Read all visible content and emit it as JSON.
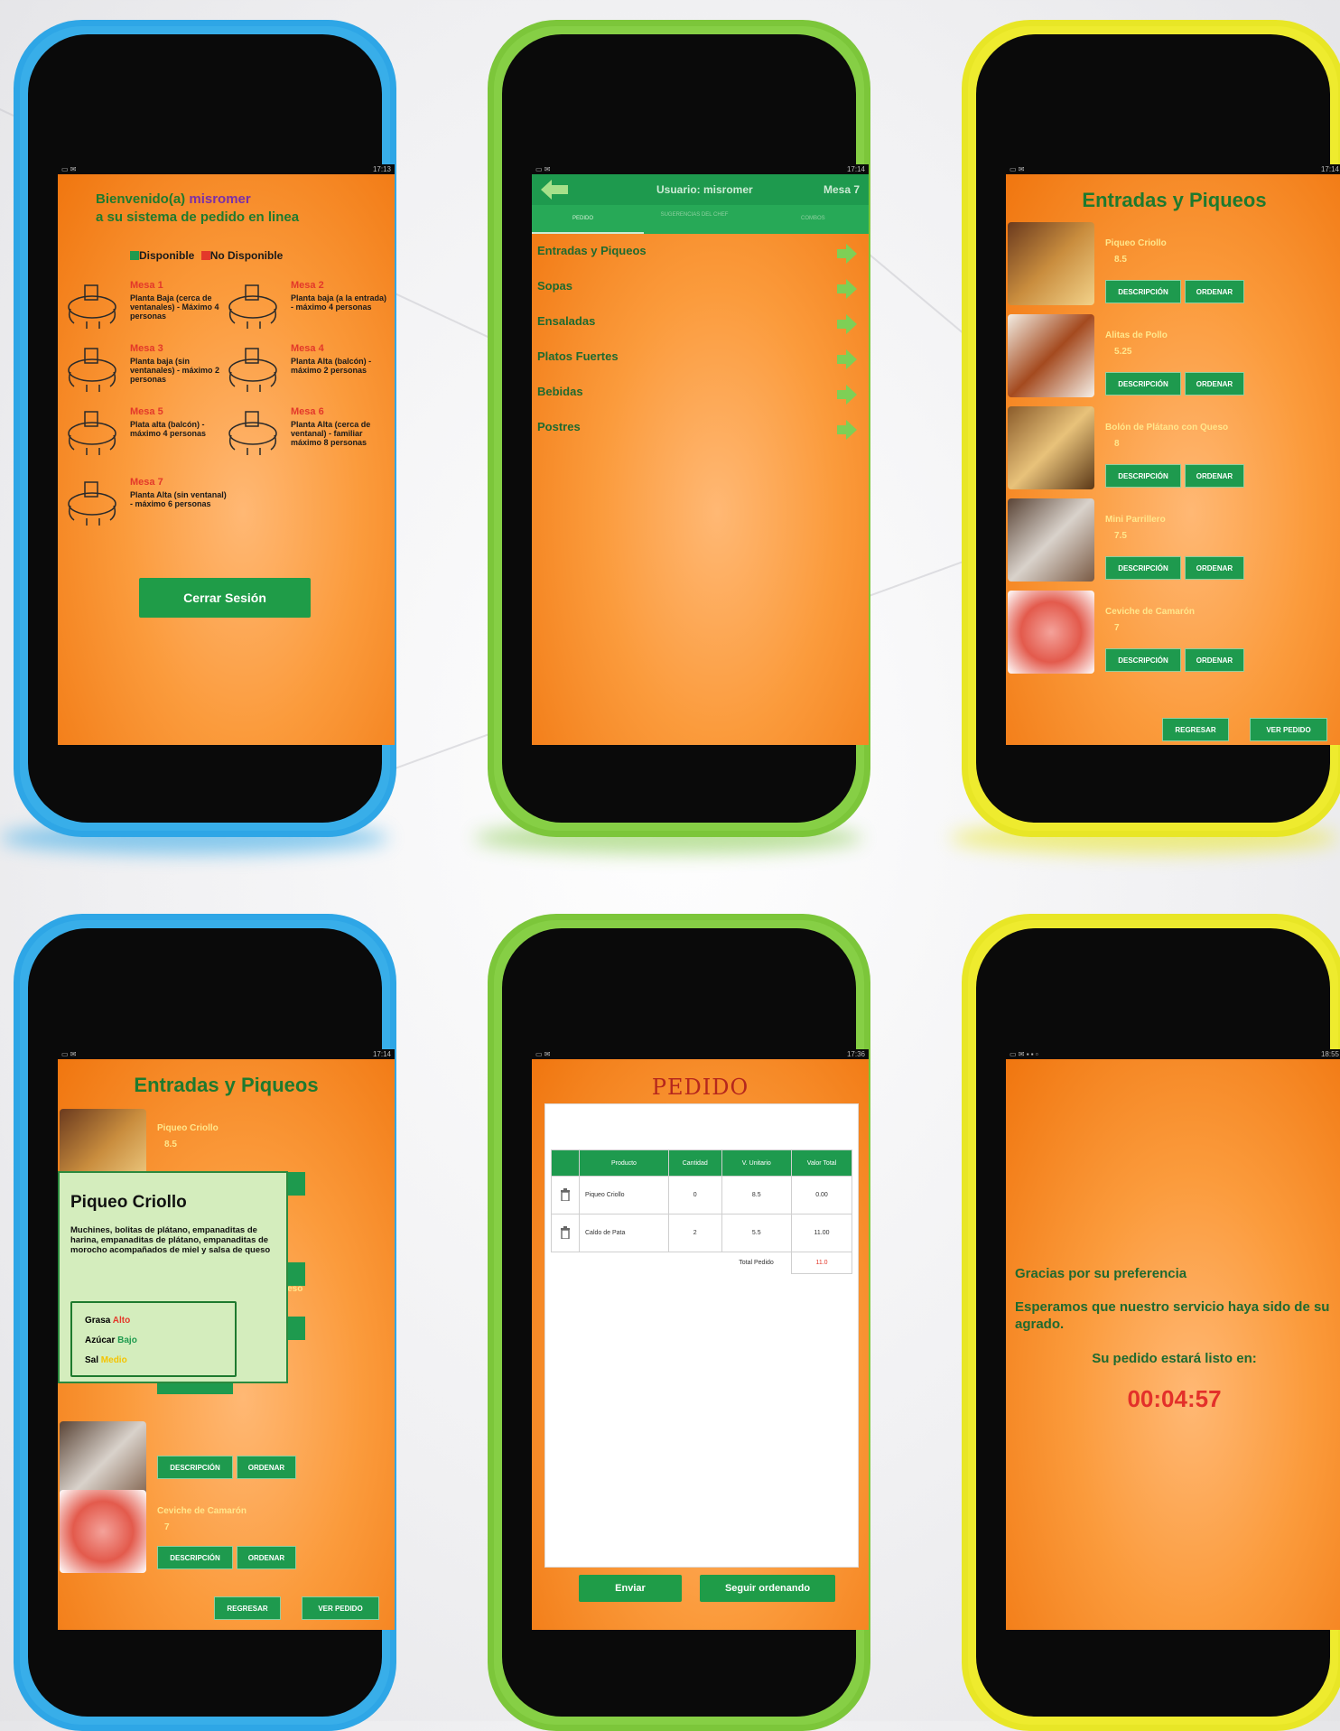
{
  "status_bar": {
    "time_1": "17:13",
    "time_2": "17:14",
    "time_3": "17:14",
    "time_4": "17:14",
    "time_5": "17:36",
    "time_6": "18:55"
  },
  "screen1": {
    "welcome_prefix": "Bienvenido(a) ",
    "username": "misromer",
    "subtitle": "a su sistema de pedido en linea",
    "legend_available": "Disponible",
    "legend_unavailable": "No Disponible",
    "available_color": "#1e9a4e",
    "unavailable_color": "#e3382a",
    "tables": [
      {
        "name": "Mesa 1",
        "desc": "Planta Baja (cerca de ventanales) - Máximo 4 personas"
      },
      {
        "name": "Mesa 2",
        "desc": "Planta baja (a la entrada) - máximo 4 personas"
      },
      {
        "name": "Mesa 3",
        "desc": "Planta baja (sin ventanales) - máximo 2 personas"
      },
      {
        "name": "Mesa 4",
        "desc": "Planta Alta (balcón) - máximo 2 personas"
      },
      {
        "name": "Mesa 5",
        "desc": "Plata alta (balcón) - máximo 4 personas"
      },
      {
        "name": "Mesa 6",
        "desc": "Planta Alta (cerca de ventanal) - familiar máximo 8 personas"
      },
      {
        "name": "Mesa 7",
        "desc": "Planta Alta (sin ventanal) - máximo 6 personas"
      }
    ],
    "logout_label": "Cerrar Sesión"
  },
  "screen2": {
    "user_label": "Usuario: misromer",
    "table_label": "Mesa 7",
    "tabs": [
      "PEDIDO",
      "SUGERENCIAS DEL CHEF",
      "COMBOS"
    ],
    "categories": [
      "Entradas y Piqueos",
      "Sopas",
      "Ensaladas",
      "Platos Fuertes",
      "Bebidas",
      "Postres"
    ]
  },
  "screen3": {
    "title": "Entradas y Piqueos",
    "items": [
      {
        "name": "Piqueo Criollo",
        "price": "8.5"
      },
      {
        "name": "Alitas de Pollo",
        "price": "5.25"
      },
      {
        "name": "Bolón de Plátano con Queso",
        "price": "8"
      },
      {
        "name": "Mini Parrillero",
        "price": "7.5"
      },
      {
        "name": "Ceviche de Camarón",
        "price": "7"
      }
    ],
    "desc_btn": "DESCRIPCIÓN",
    "order_btn": "ORDENAR",
    "back_btn": "REGRESAR",
    "view_btn": "VER PEDIDO"
  },
  "screen4": {
    "title": "Entradas y Piqueos",
    "item1_name": "Piqueo Criollo",
    "item1_price": "8.5",
    "item5_name": "Ceviche de Camarón",
    "item5_price": "7",
    "partial_text": "ueso",
    "popup_title": "Piqueo Criollo",
    "popup_desc": "Muchines, bolitas de plátano, empanaditas de harina, empanaditas de plátano, empanaditas de morocho acompañados de miel y salsa de queso",
    "nutrition": [
      {
        "label": "Grasa",
        "value": "Alto",
        "color": "#e3382a"
      },
      {
        "label": "Azúcar",
        "value": "Bajo",
        "color": "#1e9a4e"
      },
      {
        "label": "Sal",
        "value": "Medio",
        "color": "#f5c400"
      }
    ],
    "desc_btn": "DESCRIPCIÓN",
    "order_btn": "ORDENAR",
    "back_btn": "REGRESAR",
    "view_btn": "VER PEDIDO"
  },
  "screen5": {
    "title": "PEDIDO",
    "headers": [
      "Producto",
      "Cantidad",
      "V. Unitario",
      "Valor Total"
    ],
    "rows": [
      {
        "product": "Piqueo Criollo",
        "qty": "0",
        "unit": "8.5",
        "total": "0.00"
      },
      {
        "product": "Caldo de Pata",
        "qty": "2",
        "unit": "5.5",
        "total": "11.00"
      }
    ],
    "total_label": "Total Pedido",
    "total_value": "11.0",
    "send_btn": "Enviar",
    "continue_btn": "Seguir ordenando"
  },
  "screen6": {
    "thanks": "Gracias por su preferencia",
    "hope": "Esperamos que nuestro servicio haya sido de su agrado.",
    "ready": "Su pedido estará listo en:",
    "timer": "00:04:57"
  }
}
